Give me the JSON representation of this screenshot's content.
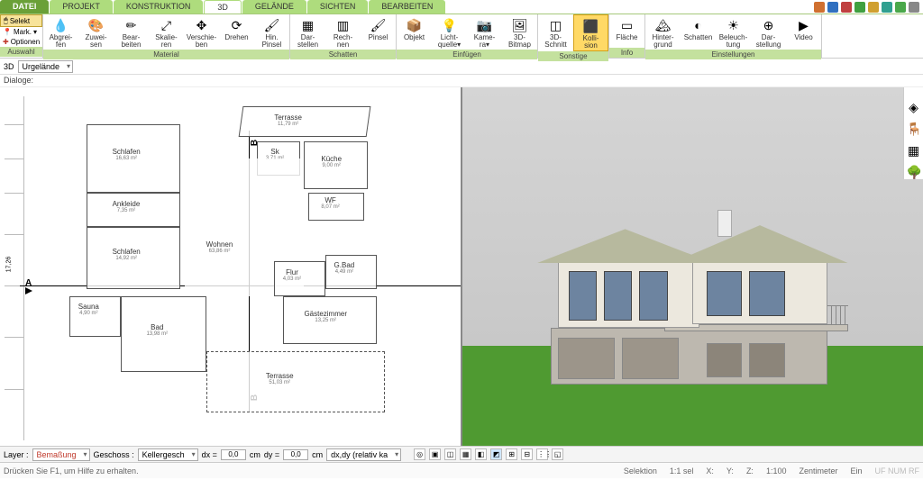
{
  "menu": {
    "file": "DATEI",
    "tabs": [
      "PROJEKT",
      "KONSTRUKTION",
      "3D",
      "GELÄNDE",
      "SICHTEN",
      "BEARBEITEN"
    ],
    "active": "3D"
  },
  "left_opts": {
    "select": "Selekt",
    "mark": "Mark.",
    "options": "Optionen",
    "group": "Auswahl"
  },
  "ribbon_groups": [
    {
      "label": "Material",
      "btns": [
        {
          "l1": "Abgrei-",
          "l2": "fen",
          "i": "💧"
        },
        {
          "l1": "Zuwei-",
          "l2": "sen",
          "i": "🎨"
        },
        {
          "l1": "Bear-",
          "l2": "beiten",
          "i": "✏"
        },
        {
          "l1": "Skalie-",
          "l2": "ren",
          "i": "⤢"
        },
        {
          "l1": "Verschie-",
          "l2": "ben",
          "i": "✥"
        },
        {
          "l1": "Drehen",
          "l2": "",
          "i": "⟳"
        },
        {
          "l1": "Hin.",
          "l2": "Pinsel",
          "i": "🖌"
        }
      ]
    },
    {
      "label": "Schatten",
      "btns": [
        {
          "l1": "Dar-",
          "l2": "stellen",
          "i": "▦"
        },
        {
          "l1": "Rech-",
          "l2": "nen",
          "i": "▥"
        },
        {
          "l1": "Pinsel",
          "l2": "",
          "i": "🖌"
        }
      ]
    },
    {
      "label": "Einfügen",
      "btns": [
        {
          "l1": "Objekt",
          "l2": "",
          "i": "📦"
        },
        {
          "l1": "Licht-",
          "l2": "quelle▾",
          "i": "💡"
        },
        {
          "l1": "Kame-",
          "l2": "ra▾",
          "i": "📷"
        },
        {
          "l1": "3D-",
          "l2": "Bitmap",
          "i": "🖼"
        }
      ]
    },
    {
      "label": "Sonstige",
      "btns": [
        {
          "l1": "3D-",
          "l2": "Schnitt",
          "i": "◫"
        },
        {
          "l1": "Kolli-",
          "l2": "sion",
          "i": "⬛",
          "hi": true
        }
      ]
    },
    {
      "label": "Info",
      "btns": [
        {
          "l1": "Fläche",
          "l2": "",
          "i": "▭"
        }
      ]
    },
    {
      "label": "Einstellungen",
      "btns": [
        {
          "l1": "Hinter-",
          "l2": "grund",
          "i": "🏔"
        },
        {
          "l1": "Schatten",
          "l2": "",
          "i": "◐"
        },
        {
          "l1": "Beleuch-",
          "l2": "tung",
          "i": "☀"
        },
        {
          "l1": "Dar-",
          "l2": "stellung",
          "i": "⊕"
        },
        {
          "l1": "Video",
          "l2": "",
          "i": "▶"
        }
      ]
    }
  ],
  "title_icons": [
    "#d07030",
    "#3070c0",
    "#c04040",
    "#40a040",
    "#d0a030",
    "#30a090",
    "#4aa84a",
    "#888"
  ],
  "secondary": {
    "mode": "3D",
    "layer": "Urgelände"
  },
  "dialog_label": "Dialoge:",
  "rooms": [
    {
      "n": "Schlafen",
      "a": "16,63 m²"
    },
    {
      "n": "Ankleide",
      "a": "7,35 m²"
    },
    {
      "n": "Schlafen",
      "a": "14,92 m²"
    },
    {
      "n": "Sauna",
      "a": "4,90 m²"
    },
    {
      "n": "Bad",
      "a": "13,98 m²"
    },
    {
      "n": "Terrasse",
      "a": "11,79 m²"
    },
    {
      "n": "Sk",
      "a": "3,71 m²"
    },
    {
      "n": "Küche",
      "a": "9,00 m²"
    },
    {
      "n": "WF",
      "a": "8,07 m²"
    },
    {
      "n": "Wohnen",
      "a": "63,86 m²"
    },
    {
      "n": "Flur",
      "a": "4,03 m²"
    },
    {
      "n": "G.Bad",
      "a": "4,49 m²"
    },
    {
      "n": "Gästezimmer",
      "a": "13,25 m²"
    },
    {
      "n": "Terrasse",
      "a": "51,03 m²"
    }
  ],
  "axes": {
    "A": "A",
    "B": "B"
  },
  "dim_label": "17,26",
  "side_tools": [
    {
      "n": "layers-icon",
      "g": "◈"
    },
    {
      "n": "furniture-icon",
      "g": "🪑"
    },
    {
      "n": "materials-icon",
      "g": "▦"
    },
    {
      "n": "tree-icon",
      "g": "🌳"
    }
  ],
  "input_bar": {
    "layer_lbl": "Layer :",
    "layer": "Bemaßung",
    "geschoss_lbl": "Geschoss :",
    "geschoss": "Kellergesch",
    "dx_lbl": "dx =",
    "dx": "0,0",
    "cm": "cm",
    "dy_lbl": "dy =",
    "dy": "0,0",
    "mode": "dx,dy (relativ ka"
  },
  "status": {
    "help": "Drücken Sie F1, um Hilfe zu erhalten.",
    "sel": "Selektion",
    "ratio": "1:1 sel",
    "x": "X:",
    "y": "Y:",
    "z": "Z:",
    "scale": "1:100",
    "unit": "Zentimeter",
    "ein": "Ein",
    "caps": "UF NUM RF"
  }
}
